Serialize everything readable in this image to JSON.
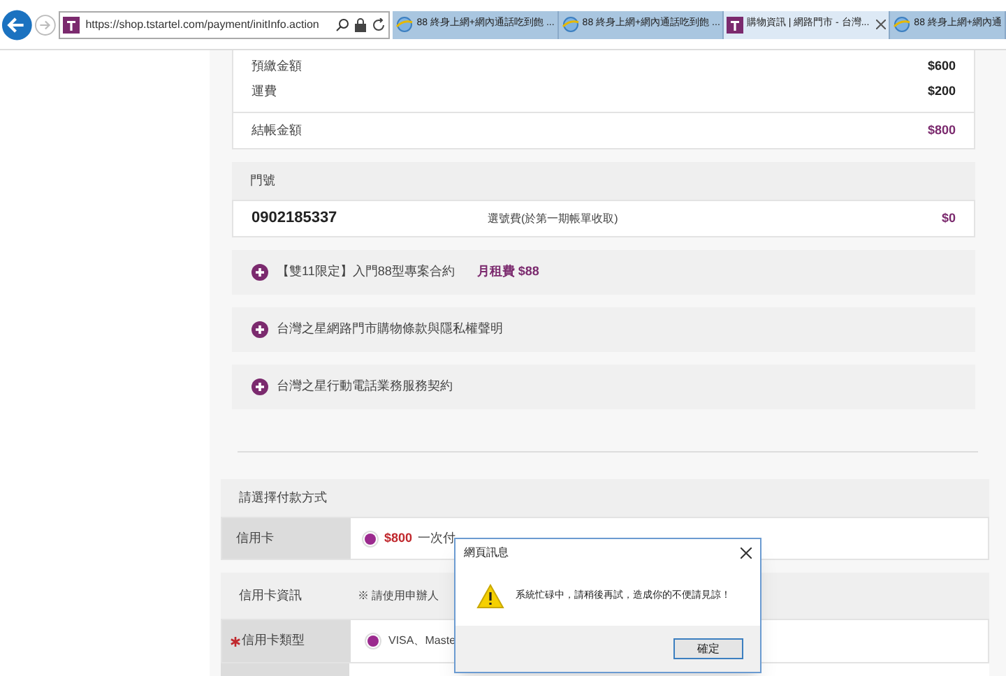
{
  "browser": {
    "address": "https://shop.tstartel.com/payment/initInfo.action",
    "tabs": [
      {
        "title": "88 終身上網+網內通話吃到飽 ...",
        "selected": false
      },
      {
        "title": "88 終身上網+網內通話吃到飽 ...",
        "selected": false
      },
      {
        "title": "購物資訊 | 網路門市 - 台灣...",
        "selected": true
      },
      {
        "title": "88 終身上網+網內通",
        "selected": false
      }
    ]
  },
  "summary": {
    "rows": [
      {
        "label": "預繳金額",
        "value": "$600",
        "kind": "item"
      },
      {
        "label": "運費",
        "value": "$200",
        "kind": "item"
      },
      {
        "label": "結帳金額",
        "value": "$800",
        "kind": "total"
      }
    ]
  },
  "phone": {
    "header": "門號",
    "number": "0902185337",
    "fee_label": "選號費(於第一期帳單收取)",
    "fee": "$0"
  },
  "accordions": [
    {
      "title": "【雙11限定】入門88型專案合約",
      "price": "月租費 $88",
      "expanded": false
    },
    {
      "title": "台灣之星網路門市購物條款與隱私權聲明",
      "expanded": false
    },
    {
      "title": "台灣之星行動電話業務服務契約",
      "expanded": false
    }
  ],
  "payment": {
    "header": "請選擇付款方式",
    "method": "信用卡",
    "selected": true,
    "amount": "$800",
    "plan": "一次付"
  },
  "card_info": {
    "header": "信用卡資訊",
    "note": "※ 請使用申辦人",
    "type_label": "信用卡類型",
    "required": true,
    "type_selected": true,
    "type_option": "VISA、Maste"
  },
  "dialog": {
    "title": "網頁訊息",
    "message": "系統忙碌中，請稍後再試，造成你的不便請見諒！",
    "button": "確定"
  }
}
